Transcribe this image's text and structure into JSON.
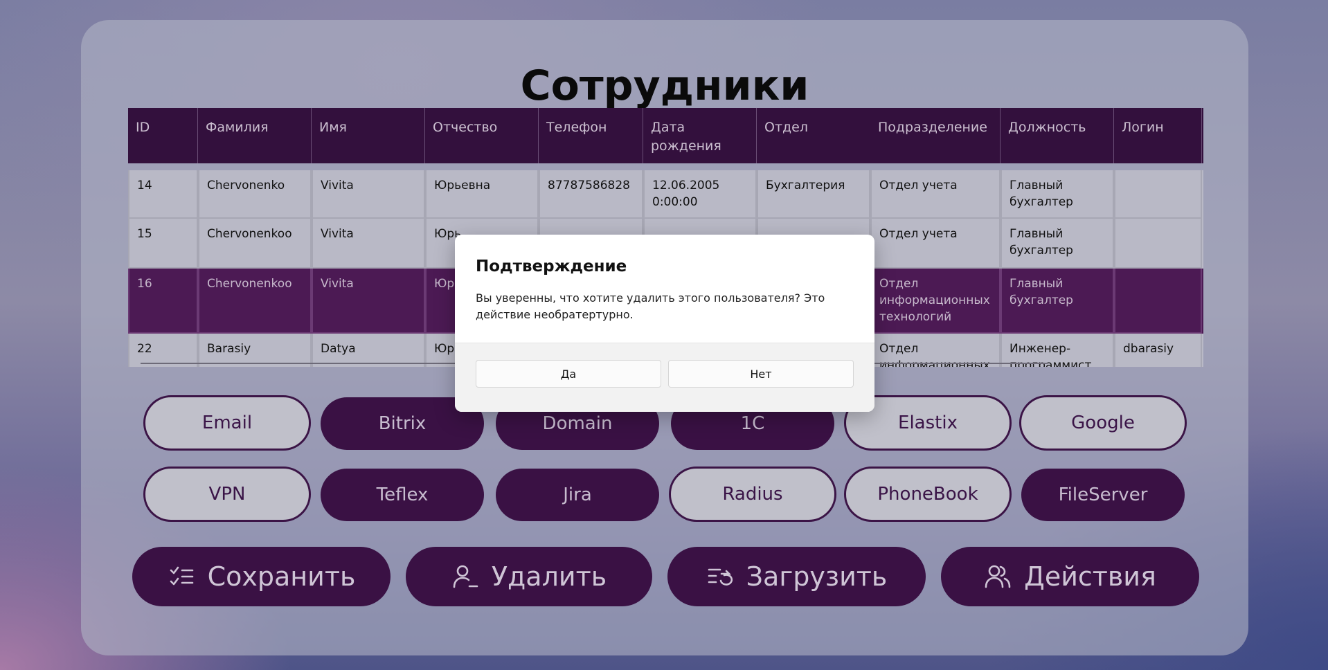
{
  "title": "Сотрудники",
  "table": {
    "columns": [
      "ID",
      "Фамилия",
      "Имя",
      "Отчество",
      "Телефон",
      "Дата рождения",
      "Отдел",
      "Подразделение",
      "Должность",
      "Логин"
    ],
    "rows": [
      {
        "id": "14",
        "last": "Chervonenko",
        "first": "Vivita",
        "middle": "Юрьевна",
        "phone": "87787586828",
        "dob": "12.06.2005 0:00:00",
        "dept": "Бухгалтерия",
        "subdiv": "Отдел учета",
        "position": "Главный бухгалтер",
        "login": ""
      },
      {
        "id": "15",
        "last": "Chervonenkoo",
        "first": "Vivita",
        "middle": "Юрь",
        "phone": "",
        "dob": "",
        "dept": "",
        "subdiv": "Отдел учета",
        "position": "Главный бухгалтер",
        "login": ""
      },
      {
        "id": "16",
        "last": "Chervonenkoo",
        "first": "Vivita",
        "middle": "Юрь",
        "phone": "",
        "dob": "",
        "dept": "",
        "subdiv": "Отдел информационных технологий",
        "position": "Главный бухгалтер",
        "login": "",
        "selected": true
      },
      {
        "id": "22",
        "last": "Barasiy",
        "first": "Datya",
        "middle": "Юрь",
        "phone": "",
        "dob": "",
        "dept": "",
        "subdiv": "Отдел информационных",
        "position": "Инженер-программист",
        "login": "dbarasiy"
      }
    ]
  },
  "services": [
    {
      "label": "Email",
      "active": false
    },
    {
      "label": "Bitrix",
      "active": true
    },
    {
      "label": "Domain",
      "active": true
    },
    {
      "label": "1C",
      "active": true
    },
    {
      "label": "Elastix",
      "active": false
    },
    {
      "label": "Google",
      "active": false
    },
    {
      "label": "VPN",
      "active": false
    },
    {
      "label": "Teflex",
      "active": true
    },
    {
      "label": "Jira",
      "active": true
    },
    {
      "label": "Radius",
      "active": false
    },
    {
      "label": "PhoneBook",
      "active": false
    },
    {
      "label": "FileServer",
      "active": true
    }
  ],
  "actions": {
    "save": {
      "label": "Сохранить",
      "icon": "checklist-icon"
    },
    "delete": {
      "label": "Удалить",
      "icon": "user-minus-icon"
    },
    "load": {
      "label": "Загрузить",
      "icon": "list-refresh-icon"
    },
    "more": {
      "label": "Действия",
      "icon": "users-icon"
    }
  },
  "dialog": {
    "title": "Подтверждение",
    "message": "Вы уверенны, что хотите удалить этого пользователя? Это действие необратертурно.",
    "yes": "Да",
    "no": "Нет"
  },
  "colors": {
    "accent": "#3a1144",
    "selected_row": "#4c1a54",
    "row_bg": "#b9b9c6"
  }
}
